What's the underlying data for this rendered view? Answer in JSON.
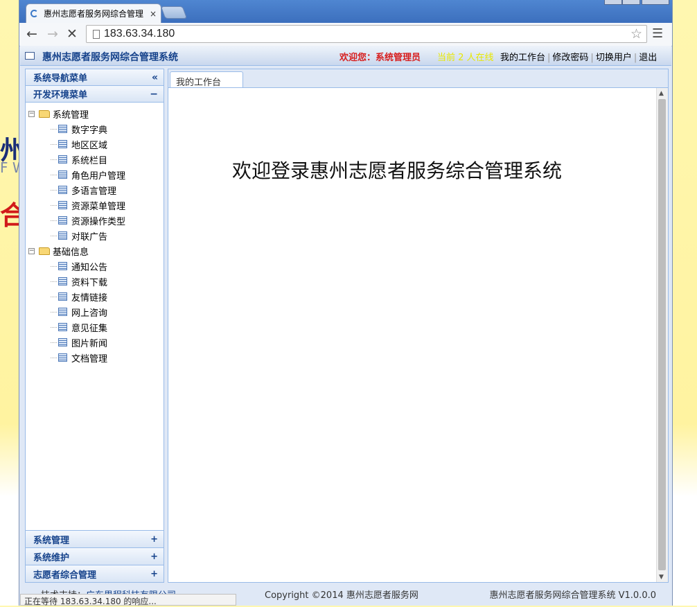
{
  "background": {
    "frag_a": "州",
    "frag_b": "F W",
    "frag_c": "合管"
  },
  "browser": {
    "tab_title": "惠州志愿者服务网综合管理",
    "tab_close": "×",
    "address": "183.63.34.180",
    "status": "正在等待 183.63.34.180 的响应..."
  },
  "header": {
    "title": "惠州志愿者服务网综合管理系统",
    "welcome": "欢迎您：系统管理员",
    "online": "当前 2 人在线",
    "links": [
      "我的工作台",
      "修改密码",
      "切换用户",
      "退出"
    ]
  },
  "sidebar": {
    "nav_title": "系统导航菜单",
    "nav_collapse": "«",
    "dev_menu": "开发环境菜单",
    "dev_toggle": "−",
    "folders": [
      {
        "label": "系统管理",
        "items": [
          "数字字典",
          "地区区域",
          "系统栏目",
          "角色用户管理",
          "多语言管理",
          "资源菜单管理",
          "资源操作类型",
          "对联广告"
        ]
      },
      {
        "label": "基础信息",
        "items": [
          "通知公告",
          "资料下载",
          "友情链接",
          "网上咨询",
          "意见征集",
          "图片新闻",
          "文档管理"
        ]
      }
    ],
    "accordion": [
      {
        "label": "系统管理",
        "toggle": "+"
      },
      {
        "label": "系统维护",
        "toggle": "+"
      },
      {
        "label": "志愿者综合管理",
        "toggle": "+"
      }
    ]
  },
  "main": {
    "tab": "我的工作台",
    "welcome_text": "欢迎登录惠州志愿者服务综合管理系统"
  },
  "footer": {
    "support_label": "技术支持：",
    "support_company": "广东思程科技有限公司",
    "copyright": "Copyright ©2014 惠州志愿者服务网",
    "version": "惠州志愿者服务网综合管理系统 V1.0.0.0"
  }
}
